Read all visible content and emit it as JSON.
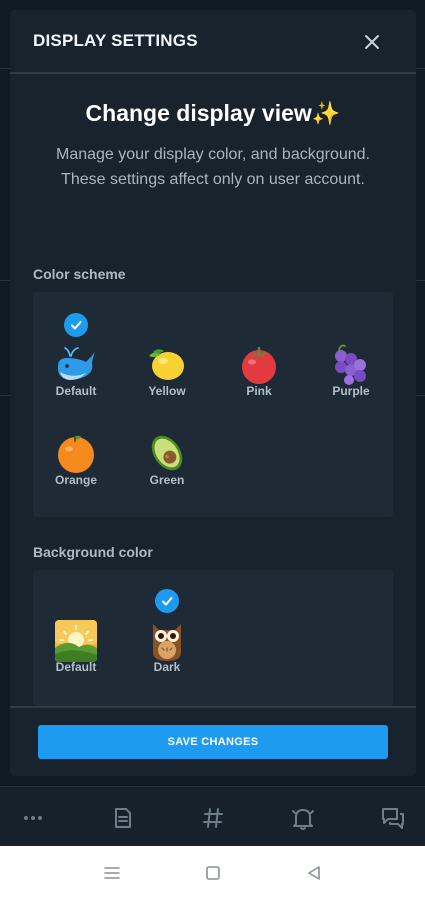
{
  "modal": {
    "title": "DISPLAY SETTINGS",
    "heading": "Change display view✨",
    "description": "Manage your display color, and background. These settings affect only on user account."
  },
  "color_scheme": {
    "label": "Color scheme",
    "selected": "Default",
    "options": [
      {
        "label": "Default",
        "icon": "whale-icon"
      },
      {
        "label": "Yellow",
        "icon": "lemon-icon"
      },
      {
        "label": "Pink",
        "icon": "tomato-icon"
      },
      {
        "label": "Purple",
        "icon": "grapes-icon"
      },
      {
        "label": "Orange",
        "icon": "orange-icon"
      },
      {
        "label": "Green",
        "icon": "avocado-icon"
      }
    ]
  },
  "background_color": {
    "label": "Background color",
    "selected": "Dark",
    "options": [
      {
        "label": "Default",
        "icon": "sunrise-landscape-icon"
      },
      {
        "label": "Dark",
        "icon": "owl-icon"
      }
    ]
  },
  "save_button": {
    "label": "SAVE CHANGES"
  },
  "bottom_nav": [
    {
      "icon": "more-dots-icon"
    },
    {
      "icon": "document-icon"
    },
    {
      "icon": "hashtag-icon"
    },
    {
      "icon": "bell-icon"
    },
    {
      "icon": "messages-icon"
    }
  ],
  "system_nav": [
    {
      "icon": "menu-icon"
    },
    {
      "icon": "home-square-icon"
    },
    {
      "icon": "back-triangle-icon"
    }
  ],
  "colors": {
    "accent": "#1d9bf0",
    "modal_bg": "#18232e",
    "panel_bg": "#1e2b37"
  }
}
